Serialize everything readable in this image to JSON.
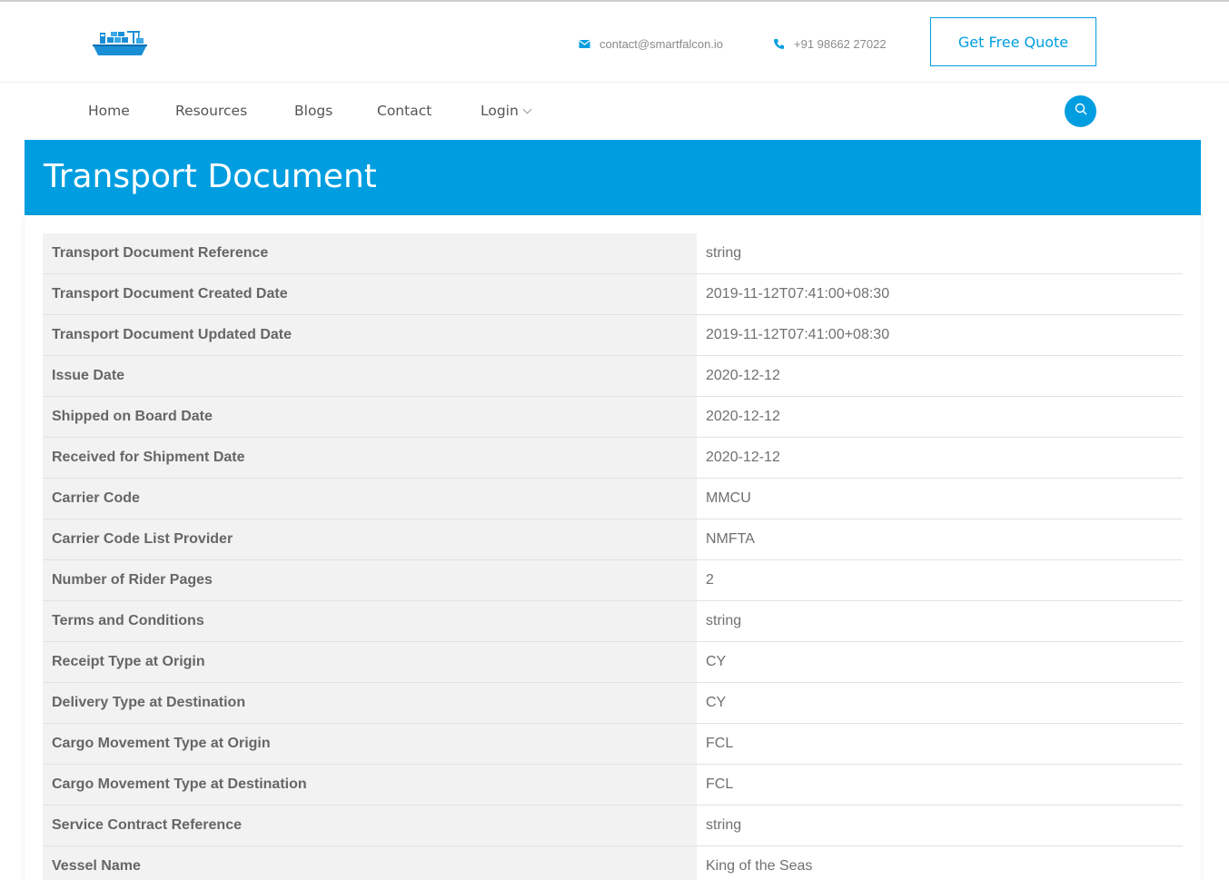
{
  "header": {
    "logo": "ship-logo-icon",
    "email": "contact@smartfalcon.io",
    "phone": "+91 98662 27022",
    "quote_button": "Get Free Quote",
    "accent_color": "#009ee0"
  },
  "nav": {
    "items": [
      {
        "label": "Home"
      },
      {
        "label": "Resources"
      },
      {
        "label": "Blogs"
      },
      {
        "label": "Contact"
      },
      {
        "label": "Login"
      }
    ],
    "search_icon": "search-icon"
  },
  "banner": {
    "title": "Transport Document"
  },
  "document": {
    "rows": [
      {
        "label": "Transport Document Reference",
        "value": "string"
      },
      {
        "label": "Transport Document Created Date",
        "value": "2019-11-12T07:41:00+08:30"
      },
      {
        "label": "Transport Document Updated Date",
        "value": "2019-11-12T07:41:00+08:30"
      },
      {
        "label": "Issue Date",
        "value": "2020-12-12"
      },
      {
        "label": "Shipped on Board Date",
        "value": "2020-12-12"
      },
      {
        "label": "Received for Shipment Date",
        "value": "2020-12-12"
      },
      {
        "label": "Carrier Code",
        "value": "MMCU"
      },
      {
        "label": "Carrier Code List Provider",
        "value": "NMFTA"
      },
      {
        "label": "Number of Rider Pages",
        "value": "2"
      },
      {
        "label": "Terms and Conditions",
        "value": "string"
      },
      {
        "label": "Receipt Type at Origin",
        "value": "CY"
      },
      {
        "label": "Delivery Type at Destination",
        "value": "CY"
      },
      {
        "label": "Cargo Movement Type at Origin",
        "value": "FCL"
      },
      {
        "label": "Cargo Movement Type at Destination",
        "value": "FCL"
      },
      {
        "label": "Service Contract Reference",
        "value": "string"
      },
      {
        "label": "Vessel Name",
        "value": "King of the Seas"
      }
    ]
  }
}
